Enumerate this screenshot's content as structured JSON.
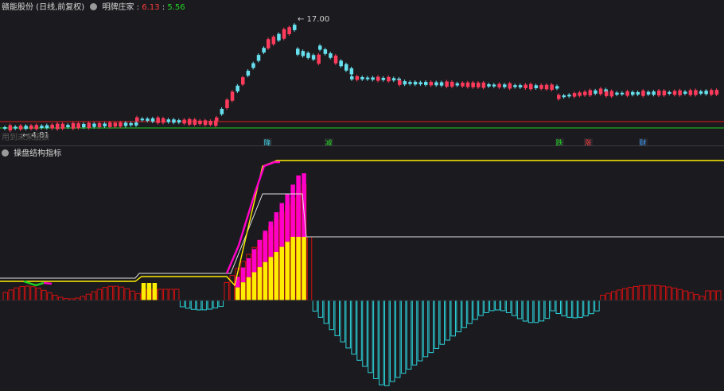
{
  "price_panel": {
    "title": "赣能股份 (日线,前复权)",
    "indicator_name": "明牌庄家",
    "value_red": "6.13",
    "value_green": "5.56",
    "high_label": "17.00",
    "low_label": "4.81",
    "watermark": "用到未来函数",
    "tags": [
      {
        "text": "降",
        "color": "#3fd0e0"
      },
      {
        "text": "减",
        "color": "#21d521"
      },
      {
        "text": "跌",
        "color": "#21d521"
      },
      {
        "text": "涨",
        "color": "#ff3b3b"
      },
      {
        "text": "财",
        "color": "#3fa0ff"
      }
    ]
  },
  "indicator_panel": {
    "title": "操盘结构指标"
  },
  "colors": {
    "up": "#ff3b5c",
    "down": "#66e0ee",
    "pos_bar": "#d01010",
    "neg_bar": "#2bd0d8",
    "magenta": "#ff00c8",
    "yellow": "#ffee00",
    "white_line": "#e0e0e0",
    "red_line": "#e01818",
    "green_line": "#20d020"
  }
}
